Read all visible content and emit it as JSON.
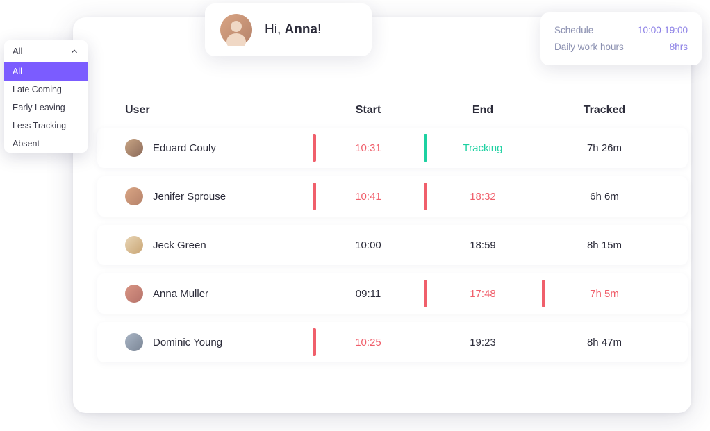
{
  "greeting": {
    "prefix": "Hi, ",
    "name": "Anna",
    "suffix": "!"
  },
  "schedule": {
    "row1_label": "Schedule",
    "row1_value": "10:00-19:00",
    "row2_label": "Daily work hours",
    "row2_value": "8hrs"
  },
  "filter": {
    "selected": "All",
    "items": [
      "All",
      "Late Coming",
      "Early Leaving",
      "Less Tracking",
      "Absent"
    ]
  },
  "table": {
    "headers": {
      "user": "User",
      "start": "Start",
      "end": "End",
      "tracked": "Tracked"
    },
    "rows": [
      {
        "name": "Eduard Couly",
        "start": "10:31",
        "start_flag": "red",
        "end": "Tracking",
        "end_flag": "green",
        "end_color": "green",
        "tracked": "7h 26m",
        "tracked_flag": "",
        "av": "av1"
      },
      {
        "name": "Jenifer Sprouse",
        "start": "10:41",
        "start_flag": "red",
        "end": "18:32",
        "end_flag": "red",
        "end_color": "red",
        "tracked": "6h 6m",
        "tracked_flag": "",
        "av": "av2"
      },
      {
        "name": "Jeck Green",
        "start": "10:00",
        "start_flag": "",
        "end": "18:59",
        "end_flag": "",
        "end_color": "",
        "tracked": "8h 15m",
        "tracked_flag": "",
        "av": "av3"
      },
      {
        "name": "Anna Muller",
        "start": "09:11",
        "start_flag": "",
        "end": "17:48",
        "end_flag": "red",
        "end_color": "red",
        "tracked": "7h 5m",
        "tracked_flag": "red",
        "tracked_color": "red",
        "av": "av4"
      },
      {
        "name": "Dominic Young",
        "start": "10:25",
        "start_flag": "red",
        "end": "19:23",
        "end_flag": "",
        "end_color": "",
        "tracked": "8h 47m",
        "tracked_flag": "",
        "av": "av5"
      }
    ]
  }
}
